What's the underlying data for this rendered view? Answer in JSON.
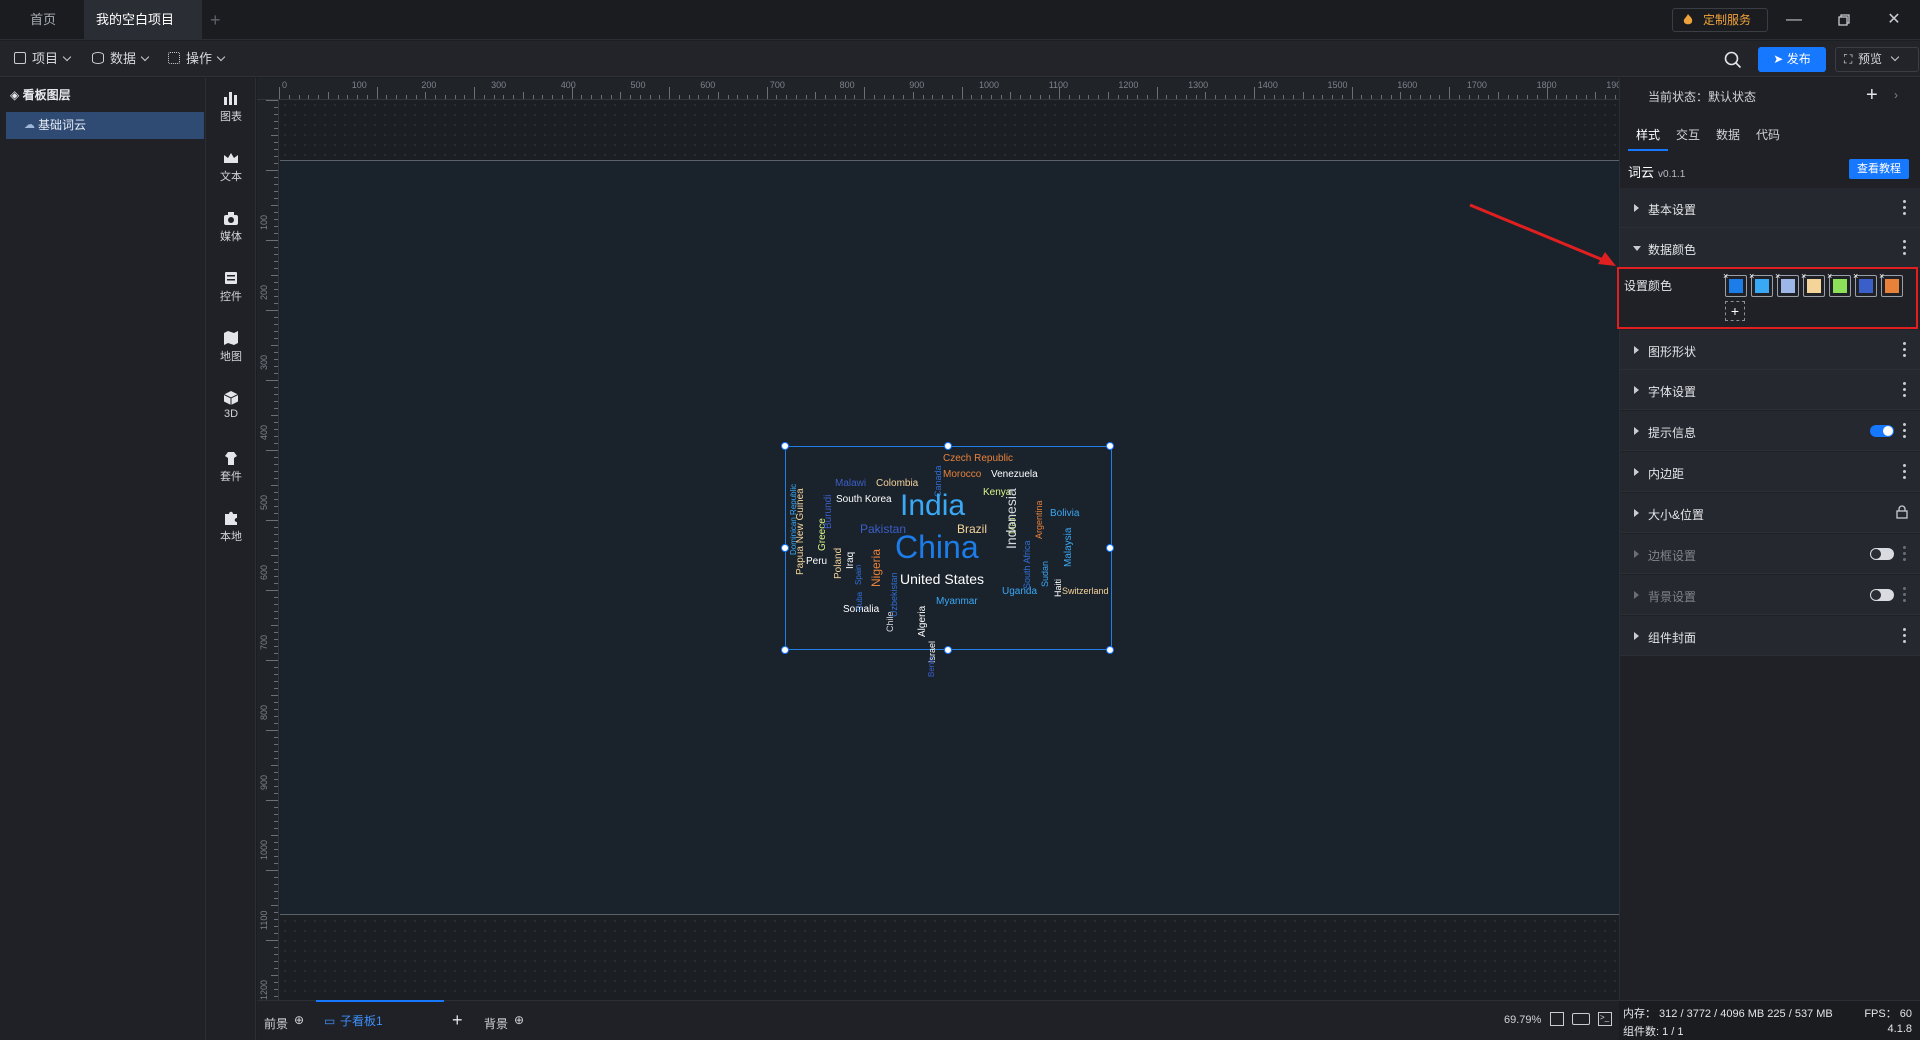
{
  "titlebar": {
    "tabs": [
      {
        "label": "首页"
      },
      {
        "label": "我的空白项目"
      }
    ],
    "custom_service": "定制服务"
  },
  "toolbar": {
    "menus": [
      {
        "label": "项目"
      },
      {
        "label": "数据"
      },
      {
        "label": "操作"
      }
    ],
    "publish": "发布",
    "preview": "预览"
  },
  "layers": {
    "title": "看板图层",
    "items": [
      {
        "label": "基础词云"
      }
    ]
  },
  "components": [
    {
      "label": "图表",
      "icon": "bar-chart-icon"
    },
    {
      "label": "文本",
      "icon": "text-icon"
    },
    {
      "label": "媒体",
      "icon": "media-icon"
    },
    {
      "label": "控件",
      "icon": "widget-icon"
    },
    {
      "label": "地图",
      "icon": "map-icon"
    },
    {
      "label": "3D",
      "icon": "cube-icon"
    },
    {
      "label": "套件",
      "icon": "kit-icon"
    },
    {
      "label": "本地",
      "icon": "puzzle-icon"
    }
  ],
  "ruler": {
    "top": [
      "0",
      "100",
      "200",
      "300",
      "400",
      "500",
      "600",
      "700",
      "800",
      "900",
      "1000",
      "1100",
      "1200",
      "1300",
      "1400",
      "1500",
      "1600",
      "1700",
      "1800",
      "1900"
    ],
    "left": [
      "100",
      "200",
      "300",
      "400",
      "500",
      "600",
      "700",
      "800",
      "900",
      "1000",
      "1100",
      "1200"
    ]
  },
  "wordcloud": {
    "words": [
      {
        "text": "Czech Republic",
        "color": "#e8823a"
      },
      {
        "text": "Morocco",
        "color": "#e8823a"
      },
      {
        "text": "Venezuela",
        "color": "#ffffff"
      },
      {
        "text": "Malawi",
        "color": "#3a5fc8"
      },
      {
        "text": "Colombia",
        "color": "#f5d49a"
      },
      {
        "text": "Canada",
        "color": "#2f6fd6"
      },
      {
        "text": "Kenya",
        "color": "#d8f58a"
      },
      {
        "text": "Mali",
        "color": "#d8f58a"
      },
      {
        "text": "South Korea",
        "color": "#ffffff"
      },
      {
        "text": "India",
        "color": "#3aa9f5"
      },
      {
        "text": "Bolivia",
        "color": "#3aa9f5"
      },
      {
        "text": "Pakistan",
        "color": "#3a5fc8"
      },
      {
        "text": "Brazil",
        "color": "#f5d49a"
      },
      {
        "text": "China",
        "color": "#1d7de8"
      },
      {
        "text": "Indonesia",
        "color": "#d8dbe0"
      },
      {
        "text": "Peru",
        "color": "#ffffff"
      },
      {
        "text": "United States",
        "color": "#ffffff"
      },
      {
        "text": "Nigeria",
        "color": "#e8823a"
      },
      {
        "text": "Uganda",
        "color": "#3aa9f5"
      },
      {
        "text": "Switzerland",
        "color": "#f5d49a"
      },
      {
        "text": "Somalia",
        "color": "#ffffff"
      },
      {
        "text": "Myanmar",
        "color": "#3aa9f5"
      },
      {
        "text": "Greece",
        "color": "#d8f58a"
      },
      {
        "text": "Poland",
        "color": "#f5d49a"
      },
      {
        "text": "Iraq",
        "color": "#ffffff"
      },
      {
        "text": "Burundi",
        "color": "#3a5fc8"
      },
      {
        "text": "Papua New Guinea",
        "color": "#f5d49a"
      },
      {
        "text": "Dominican Republic",
        "color": "#3aa9f5"
      },
      {
        "text": "Cuba",
        "color": "#2f6fd6"
      },
      {
        "text": "Spain",
        "color": "#2f6fd6"
      },
      {
        "text": "Chile",
        "color": "#d8dbe0"
      },
      {
        "text": "Uzbekistan",
        "color": "#2f6fd6"
      },
      {
        "text": "Algeria",
        "color": "#ffffff"
      },
      {
        "text": "Israel",
        "color": "#ffffff"
      },
      {
        "text": "Benin",
        "color": "#3a5fc8"
      },
      {
        "text": "South Africa",
        "color": "#2f6fd6"
      },
      {
        "text": "Argentina",
        "color": "#e8823a"
      },
      {
        "text": "Sudan",
        "color": "#3aa9f5"
      },
      {
        "text": "Haiti",
        "color": "#ffffff"
      },
      {
        "text": "Malaysia",
        "color": "#3aa9f5"
      }
    ]
  },
  "bottombar": {
    "foreground": "前景",
    "subboard": "子看板1",
    "background": "背景",
    "zoom": "69.79%"
  },
  "rightpanel": {
    "state": "当前状态：默认状态",
    "tabs": [
      {
        "label": "样式"
      },
      {
        "label": "交互"
      },
      {
        "label": "数据"
      },
      {
        "label": "代码"
      }
    ],
    "component_name": "词云",
    "component_version": "v0.1.1",
    "tutorial": "查看教程",
    "sections": [
      {
        "label": "基本设置"
      },
      {
        "label": "数据颜色"
      },
      {
        "label": "图形形状"
      },
      {
        "label": "字体设置"
      },
      {
        "label": "提示信息"
      },
      {
        "label": "内边距"
      },
      {
        "label": "大小&位置"
      },
      {
        "label": "边框设置"
      },
      {
        "label": "背景设置"
      },
      {
        "label": "组件封面"
      }
    ],
    "color_label": "设置颜色",
    "colors": [
      "#1d7de8",
      "#3aa9f5",
      "#9db8e8",
      "#f5d49a",
      "#8de05a",
      "#3a5fc8",
      "#e8823a"
    ],
    "add_symbol": "+"
  },
  "status": {
    "memory": "内存： 312 / 3772 / 4096 MB 225 / 537 MB",
    "fps": "FPS： 60",
    "count": "组件数: 1 / 1",
    "version": "4.1.8"
  }
}
